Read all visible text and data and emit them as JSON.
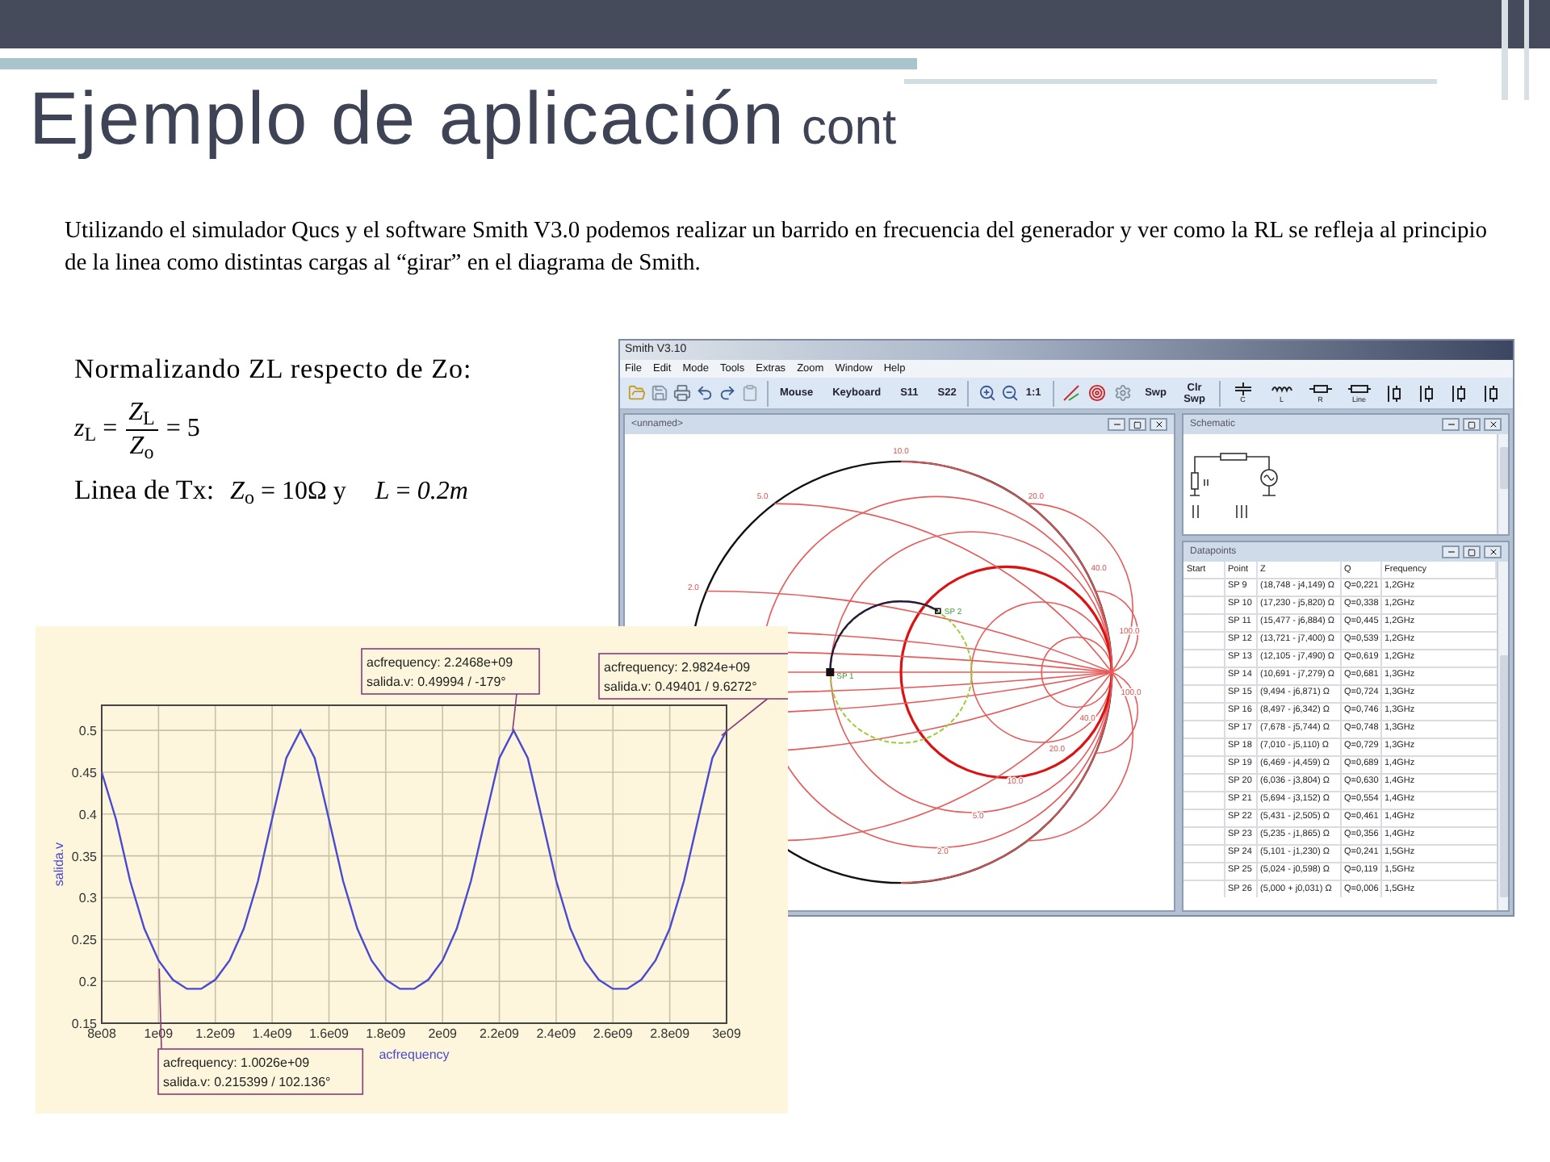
{
  "slide": {
    "title": "Ejemplo de aplicación",
    "title_suffix": "cont",
    "intro": "Utilizando el simulador Qucs y el software Smith V3.0  podemos realizar un barrido en frecuencia del generador y ver como la RL se refleja al principio de la linea como distintas cargas al “girar” en el diagrama de Smith."
  },
  "formulas": {
    "heading": "Normalizando ZL respecto de Zo:",
    "zl_lhs": "*z*$_{L}$ =",
    "zl_num": "*Z*$_{L}$",
    "zl_den": "*Z*$_{o}$",
    "zl_rhs": "= 5",
    "line_label": "Linea de Tx:",
    "line_zo": "*Z*$_{o}$ = 10Ω y",
    "line_len": "*L* = *0.2m*"
  },
  "smith_window": {
    "title": "Smith V3.10",
    "menu": [
      "File",
      "Edit",
      "Mode",
      "Tools",
      "Extras",
      "Zoom",
      "Window",
      "Help"
    ],
    "toolbar": {
      "modes": [
        "Mouse",
        "Keyboard",
        "S11",
        "S22"
      ],
      "zoom_label": "1:1",
      "sweep": [
        "Swp",
        "Clr Swp"
      ],
      "components": [
        "C",
        "L",
        "R",
        "Line"
      ]
    },
    "chart_window": {
      "title": "<unnamed>",
      "scale_labels": [
        "10.0",
        "5.0",
        "20.0",
        "2.0",
        "40.0",
        "100.0",
        "100.0",
        "40.0",
        "20.0",
        "10.0",
        "5.0",
        "2.0"
      ],
      "point_labels": [
        "SP 1",
        "SP 2"
      ]
    },
    "schematic_window": {
      "title": "Schematic"
    },
    "datapoints_window": {
      "title": "Datapoints",
      "columns": [
        "Start",
        "Point",
        "Z",
        "Q",
        "Frequency"
      ],
      "rows": [
        {
          "point": "SP 9",
          "z": "(18,748 - j4,149) Ω",
          "q": "Q=0,221",
          "frequency": "1,2GHz"
        },
        {
          "point": "SP 10",
          "z": "(17,230 - j5,820) Ω",
          "q": "Q=0,338",
          "frequency": "1,2GHz"
        },
        {
          "point": "SP 11",
          "z": "(15,477 - j6,884) Ω",
          "q": "Q=0,445",
          "frequency": "1,2GHz"
        },
        {
          "point": "SP 12",
          "z": "(13,721 - j7,400) Ω",
          "q": "Q=0,539",
          "frequency": "1,2GHz"
        },
        {
          "point": "SP 13",
          "z": "(12,105 - j7,490) Ω",
          "q": "Q=0,619",
          "frequency": "1,2GHz"
        },
        {
          "point": "SP 14",
          "z": "(10,691 - j7,279) Ω",
          "q": "Q=0,681",
          "frequency": "1,3GHz"
        },
        {
          "point": "SP 15",
          "z": "(9,494 - j6,871) Ω",
          "q": "Q=0,724",
          "frequency": "1,3GHz"
        },
        {
          "point": "SP 16",
          "z": "(8,497 - j6,342) Ω",
          "q": "Q=0,746",
          "frequency": "1,3GHz"
        },
        {
          "point": "SP 17",
          "z": "(7,678 - j5,744) Ω",
          "q": "Q=0,748",
          "frequency": "1,3GHz"
        },
        {
          "point": "SP 18",
          "z": "(7,010 - j5,110) Ω",
          "q": "Q=0,729",
          "frequency": "1,3GHz"
        },
        {
          "point": "SP 19",
          "z": "(6,469 - j4,459) Ω",
          "q": "Q=0,689",
          "frequency": "1,4GHz"
        },
        {
          "point": "SP 20",
          "z": "(6,036 - j3,804) Ω",
          "q": "Q=0,630",
          "frequency": "1,4GHz"
        },
        {
          "point": "SP 21",
          "z": "(5,694 - j3,152) Ω",
          "q": "Q=0,554",
          "frequency": "1,4GHz"
        },
        {
          "point": "SP 22",
          "z": "(5,431 - j2,505) Ω",
          "q": "Q=0,461",
          "frequency": "1,4GHz"
        },
        {
          "point": "SP 23",
          "z": "(5,235 - j1,865) Ω",
          "q": "Q=0,356",
          "frequency": "1,4GHz"
        },
        {
          "point": "SP 24",
          "z": "(5,101 - j1,230) Ω",
          "q": "Q=0,241",
          "frequency": "1,5GHz"
        },
        {
          "point": "SP 25",
          "z": "(5,024 - j0,598) Ω",
          "q": "Q=0,119",
          "frequency": "1,5GHz"
        },
        {
          "point": "SP 26",
          "z": "(5,000 + j0,031) Ω",
          "q": "Q=0,006",
          "frequency": "1,5GHz"
        }
      ]
    }
  },
  "frequency_plot": {
    "chart_data": {
      "type": "line",
      "xlabel": "acfrequency",
      "ylabel": "salida.v",
      "x": [
        800000000,
        850000000,
        900000000,
        950000000,
        1000000000,
        1050000000,
        1100000000,
        1150000000,
        1200000000,
        1250000000,
        1300000000,
        1350000000,
        1400000000,
        1450000000,
        1500000000,
        1550000000,
        1600000000,
        1650000000,
        1700000000,
        1750000000,
        1800000000,
        1850000000,
        1900000000,
        1950000000,
        2000000000,
        2050000000,
        2100000000,
        2150000000,
        2200000000,
        2250000000,
        2300000000,
        2350000000,
        2400000000,
        2450000000,
        2500000000,
        2550000000,
        2600000000,
        2650000000,
        2700000000,
        2750000000,
        2800000000,
        2850000000,
        2900000000,
        2950000000,
        3000000000
      ],
      "series": [
        {
          "color": "#4a4ad0",
          "values": [
            0.45,
            0.394,
            0.32,
            0.263,
            0.225,
            0.202,
            0.191,
            0.191,
            0.202,
            0.225,
            0.263,
            0.32,
            0.394,
            0.467,
            0.5,
            0.467,
            0.394,
            0.32,
            0.263,
            0.225,
            0.202,
            0.191,
            0.191,
            0.202,
            0.225,
            0.263,
            0.32,
            0.394,
            0.467,
            0.5,
            0.467,
            0.394,
            0.32,
            0.263,
            0.225,
            0.202,
            0.191,
            0.191,
            0.202,
            0.225,
            0.263,
            0.32,
            0.394,
            0.467,
            0.5
          ]
        }
      ],
      "xlim": [
        800000000,
        3000000000
      ],
      "ylim": [
        0.15,
        0.53
      ],
      "xticks": [
        {
          "value": 800000000,
          "label": "8e08"
        },
        {
          "value": 1000000000,
          "label": "1e09"
        },
        {
          "value": 1200000000,
          "label": "1.2e09"
        },
        {
          "value": 1400000000,
          "label": "1.4e09"
        },
        {
          "value": 1600000000,
          "label": "1.6e09"
        },
        {
          "value": 1800000000,
          "label": "1.8e09"
        },
        {
          "value": 2000000000,
          "label": "2e09"
        },
        {
          "value": 2200000000,
          "label": "2.2e09"
        },
        {
          "value": 2400000000,
          "label": "2.4e09"
        },
        {
          "value": 2600000000,
          "label": "2.6e09"
        },
        {
          "value": 2800000000,
          "label": "2.8e09"
        },
        {
          "value": 3000000000,
          "label": "3e09"
        }
      ],
      "yticks": [
        0.15,
        0.2,
        0.25,
        0.3,
        0.35,
        0.4,
        0.45,
        0.5
      ],
      "grid": true
    },
    "markers": [
      {
        "frequency": "acfrequency: 2.2468e+09",
        "value": "salida.v: 0.49994 / -179°"
      },
      {
        "frequency": "acfrequency: 2.9824e+09",
        "value": "salida.v: 0.49401 / 9.6272°"
      },
      {
        "frequency": "acfrequency: 1.0026e+09",
        "value": "salida.v: 0.215399 / 102.136°"
      }
    ]
  }
}
